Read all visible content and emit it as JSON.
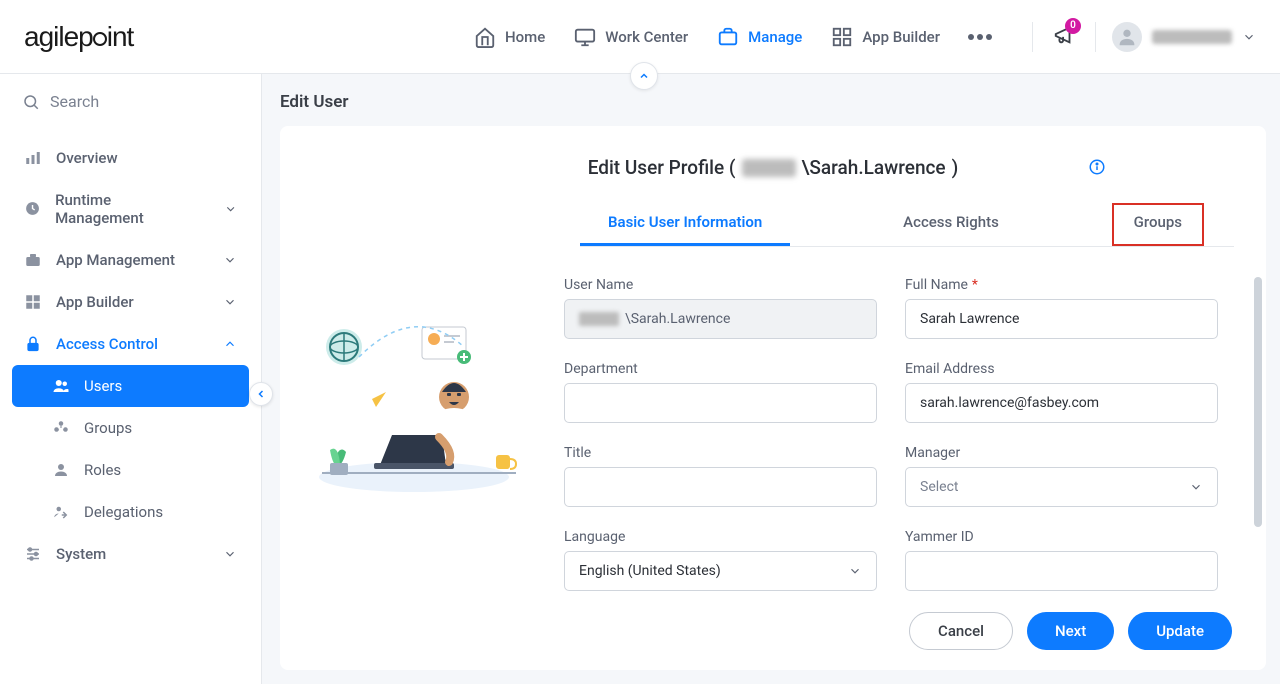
{
  "header": {
    "logo_text": "agilepoint",
    "nav": [
      {
        "label": "Home",
        "icon": "home"
      },
      {
        "label": "Work Center",
        "icon": "monitor"
      },
      {
        "label": "Manage",
        "icon": "briefcase",
        "active": true
      },
      {
        "label": "App Builder",
        "icon": "grid"
      }
    ],
    "notification_count": "0"
  },
  "sidebar": {
    "search_placeholder": "Search",
    "items": [
      {
        "label": "Overview",
        "icon": "chart"
      },
      {
        "label": "Runtime Management",
        "icon": "clock",
        "expandable": true
      },
      {
        "label": "App Management",
        "icon": "briefcase",
        "expandable": true
      },
      {
        "label": "App Builder",
        "icon": "grid",
        "expandable": true
      },
      {
        "label": "Access Control",
        "icon": "lock",
        "expandable": true,
        "expanded": true,
        "children": [
          {
            "label": "Users",
            "active": true
          },
          {
            "label": "Groups"
          },
          {
            "label": "Roles"
          },
          {
            "label": "Delegations"
          }
        ]
      },
      {
        "label": "System",
        "icon": "sliders",
        "expandable": true
      }
    ]
  },
  "page": {
    "breadcrumb": "Edit User",
    "title_prefix": "Edit User Profile (",
    "title_user": "\\Sarah.Lawrence",
    "title_suffix": ")",
    "tabs": [
      {
        "label": "Basic User Information",
        "active": true
      },
      {
        "label": "Access Rights"
      },
      {
        "label": "Groups",
        "highlighted": true
      }
    ],
    "fields": {
      "user_name": {
        "label": "User Name",
        "value": "\\Sarah.Lawrence",
        "disabled": true,
        "prefix_blurred": true
      },
      "full_name": {
        "label": "Full Name",
        "value": "Sarah Lawrence",
        "required": true
      },
      "department": {
        "label": "Department",
        "value": ""
      },
      "email": {
        "label": "Email Address",
        "value": "sarah.lawrence@fasbey.com"
      },
      "title": {
        "label": "Title",
        "value": ""
      },
      "manager": {
        "label": "Manager",
        "value": "Select",
        "is_select": true,
        "placeholder": true
      },
      "language": {
        "label": "Language",
        "value": "English (United States)",
        "is_select": true
      },
      "yammer_id": {
        "label": "Yammer ID",
        "value": ""
      }
    },
    "buttons": {
      "cancel": "Cancel",
      "next": "Next",
      "update": "Update"
    }
  }
}
